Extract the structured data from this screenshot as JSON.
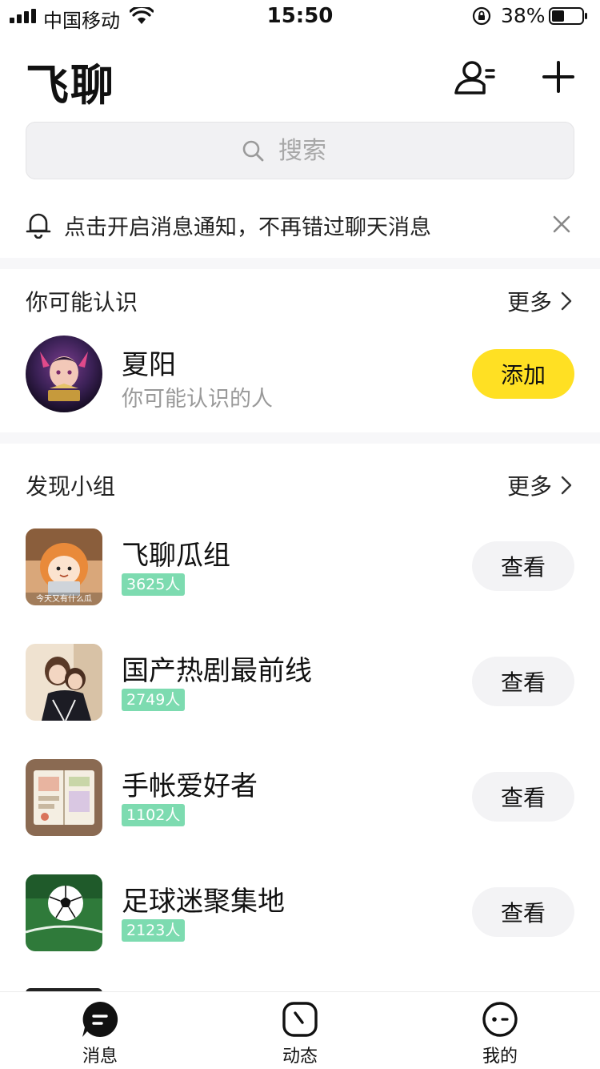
{
  "status_bar": {
    "carrier": "中国移动",
    "time": "15:50",
    "battery": "38%"
  },
  "header": {
    "title": "飞聊"
  },
  "search": {
    "placeholder": "搜索"
  },
  "notice": {
    "text": "点击开启消息通知，不再错过聊天消息"
  },
  "suggested": {
    "title": "你可能认识",
    "more": "更多",
    "person": {
      "name": "夏阳",
      "subtitle": "你可能认识的人",
      "add_label": "添加"
    }
  },
  "groups": {
    "title": "发现小组",
    "more": "更多",
    "items": [
      {
        "name": "飞聊瓜组",
        "count": "3625人",
        "action": "查看",
        "thumb_caption": "今天又有什么瓜"
      },
      {
        "name": "国产热剧最前线",
        "count": "2749人",
        "action": "查看"
      },
      {
        "name": "手帐爱好者",
        "count": "1102人",
        "action": "查看"
      },
      {
        "name": "足球迷聚集地",
        "count": "2123人",
        "action": "查看"
      }
    ]
  },
  "tabs": [
    {
      "label": "消息",
      "icon": "chat-bubble-icon"
    },
    {
      "label": "动态",
      "icon": "clock-icon"
    },
    {
      "label": "我的",
      "icon": "face-icon"
    }
  ],
  "colors": {
    "accent": "#ffe023",
    "count_badge": "#7ddbb0"
  }
}
